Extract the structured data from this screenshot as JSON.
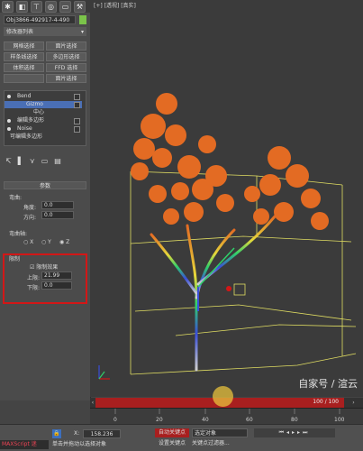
{
  "toolbar": {
    "icons": [
      "create-icon",
      "modify-icon",
      "hierarchy-icon",
      "motion-icon",
      "display-icon",
      "utilities-icon"
    ]
  },
  "panel": {
    "object_name": "Obj3866-492917-4-490",
    "modifier_list": "修改器列表",
    "buttons": [
      "网格选择",
      "面片选择",
      "样条线选择",
      "多边形选择",
      "体积选择",
      "FFD 选择",
      "",
      "面片选择"
    ],
    "stack": [
      {
        "label": "Bend",
        "selected": false
      },
      {
        "label": "Gizmo",
        "selected": true
      },
      {
        "label": "中心",
        "selected": false
      },
      {
        "label": "编辑多边形",
        "selected": false
      },
      {
        "label": "Noise",
        "selected": false
      },
      {
        "label": "可编辑多边形",
        "selected": false
      }
    ],
    "params_title": "参数",
    "bend_group": "弯曲:",
    "angle_label": "角度:",
    "angle_value": "0.0",
    "direction_label": "方向:",
    "direction_value": "0.0",
    "axis_group": "弯曲轴:",
    "axis_x": "X",
    "axis_y": "Y",
    "axis_z": "Z",
    "limit_group": "限制",
    "limit_effect": "限制效果",
    "upper_label": "上限:",
    "upper_value": "21.99",
    "lower_label": "下限:",
    "lower_value": "0.0"
  },
  "viewport": {
    "label": "[+] [透视] [真实]"
  },
  "timeline": {
    "frame_display": "100 / 100",
    "ticks": [
      "0",
      "20",
      "40",
      "60",
      "80",
      "100"
    ]
  },
  "status": {
    "maxscript_label": "MAXScript 迷",
    "hint_text": "单击并拖动以选择对象",
    "x_label": "X:",
    "x_value": "158.236",
    "autokey_label": "自动关键点",
    "selected_object": "选定对象",
    "set_key_label": "设置关键点",
    "key_filters_label": "关键点过滤器..."
  },
  "watermark": "自家号 / 渲云",
  "colors": {
    "foliage": "#e36b23",
    "bbox": "#e0dd62",
    "timebar": "#a81f1f",
    "highlight_box": "#d21717",
    "stack_selected": "#4a6fb5"
  }
}
